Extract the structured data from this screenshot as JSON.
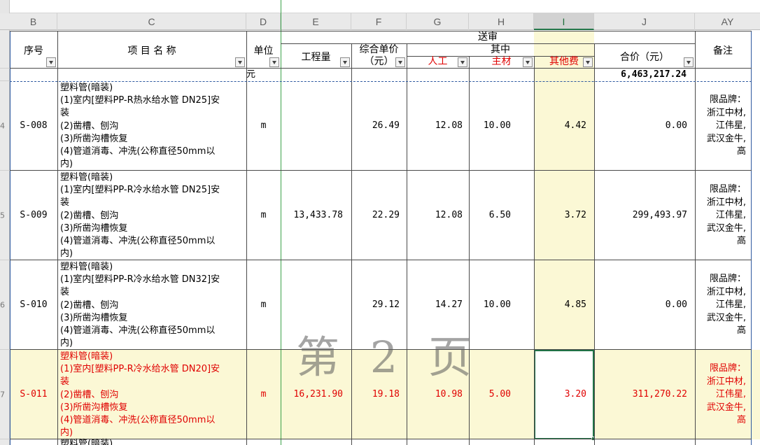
{
  "sheet": {
    "column_letters": [
      "B",
      "C",
      "D",
      "E",
      "F",
      "G",
      "H",
      "I",
      "J",
      "AY"
    ],
    "selected_column": "I",
    "row_numbers": [
      "4",
      "5",
      "6",
      "7"
    ]
  },
  "header": {
    "seq": "序号",
    "item_name": "项 目 名 称",
    "unit": "单位",
    "quantity": "工程量",
    "unit_price_line1": "综合单价",
    "unit_price_line2": "（元）",
    "submitted": "送审",
    "of_which": "其中",
    "labor": "人工",
    "material": "主材",
    "other_fee": "其他费",
    "total": "合价（元）",
    "remark": "备注"
  },
  "unit_row": {
    "unit": "元",
    "grand_total": "6,463,217.24"
  },
  "rows": [
    {
      "code": "S-008",
      "desc": [
        "塑料管(暗装)",
        "(1)室内[塑料PP-R热水给水管 DN25]安",
        "装",
        "(2)凿槽、刨沟",
        "(3)所凿沟槽恢复",
        "(4)管道消毒、冲洗(公称直径50mm以",
        "内)"
      ],
      "unit": "m",
      "quantity": "",
      "unit_price": "26.49",
      "labor": "12.08",
      "material": "10.00",
      "other": "4.42",
      "total": "0.00",
      "remark": [
        "限品牌：",
        "浙江中材,",
        "江伟星,",
        "武汉金牛,",
        "高"
      ]
    },
    {
      "code": "S-009",
      "desc": [
        "塑料管(暗装)",
        "(1)室内[塑料PP-R冷水给水管 DN25]安",
        "装",
        "(2)凿槽、刨沟",
        "(3)所凿沟槽恢复",
        "(4)管道消毒、冲洗(公称直径50mm以",
        "内)"
      ],
      "unit": "m",
      "quantity": "13,433.78",
      "unit_price": "22.29",
      "labor": "12.08",
      "material": "6.50",
      "other": "3.72",
      "total": "299,493.97",
      "remark": [
        "限品牌：",
        "浙江中材,",
        "江伟星,",
        "武汉金牛,",
        "高"
      ]
    },
    {
      "code": "S-010",
      "desc": [
        "塑料管(暗装)",
        "(1)室内[塑料PP-R冷水给水管 DN32]安",
        "装",
        "(2)凿槽、刨沟",
        "(3)所凿沟槽恢复",
        "(4)管道消毒、冲洗(公称直径50mm以",
        "内)"
      ],
      "unit": "m",
      "quantity": "",
      "unit_price": "29.12",
      "labor": "14.27",
      "material": "10.00",
      "other": "4.85",
      "total": "0.00",
      "remark": [
        "限品牌：",
        "浙江中材,",
        "江伟星,",
        "武汉金牛,",
        "高"
      ]
    },
    {
      "code": "S-011",
      "desc": [
        "塑料管(暗装)",
        "(1)室内[塑料PP-R冷水给水管 DN20]安",
        "装",
        "(2)凿槽、刨沟",
        "(3)所凿沟槽恢复",
        "(4)管道消毒、冲洗(公称直径50mm以",
        "内)"
      ],
      "unit": "m",
      "quantity": "16,231.90",
      "unit_price": "19.18",
      "labor": "10.98",
      "material": "5.00",
      "other": "3.20",
      "total": "311,270.22",
      "remark": [
        "限品牌：",
        "浙江中材,",
        "江伟星,",
        "武汉金牛,",
        "高"
      ]
    }
  ],
  "partial_next_row": "塑料管(暗装)",
  "watermark": "第 2 页",
  "colors": {
    "highlight_row": "#fbf8d5",
    "highlight_text": "#e00000",
    "selection": "#217346"
  }
}
